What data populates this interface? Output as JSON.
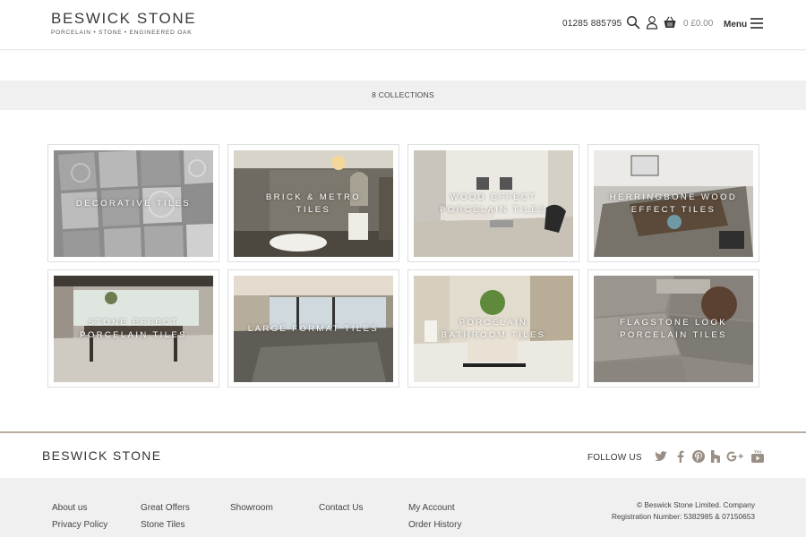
{
  "header": {
    "logo_title": "BESWICK STONE",
    "logo_tagline": "PORCELAIN • STONE • ENGINEERED OAK",
    "phone": "01285 885795",
    "cart_total": "0 £0.00",
    "menu_label": "Menu"
  },
  "collections_bar": {
    "label": "8 COLLECTIONS"
  },
  "collections": [
    {
      "label": "DECORATIVE TILES"
    },
    {
      "label": "BRICK & METRO\nTILES"
    },
    {
      "label": "WOOD EFFECT\nPORCELAIN TILES"
    },
    {
      "label": "HERRINGBONE WOOD\nEFFECT TILES"
    },
    {
      "label": "STONE EFFECT\nPORCELAIN TILES"
    },
    {
      "label": "LARGE FORMAT TILES"
    },
    {
      "label": "PORCELAIN\nBATHROOM TILES"
    },
    {
      "label": "FLAGSTONE LOOK\nPORCELAIN TILES"
    }
  ],
  "footer": {
    "logo": "BESWICK STONE",
    "follow_label": "FOLLOW US",
    "social_icons": [
      "twitter-icon",
      "facebook-icon",
      "pinterest-icon",
      "houzz-icon",
      "google-plus-icon",
      "youtube-icon"
    ],
    "social_color": "#9a8f84",
    "links": [
      [
        "About us",
        "Privacy Policy"
      ],
      [
        "Great Offers",
        "Stone Tiles"
      ],
      [
        "Showroom"
      ],
      [
        "Contact Us"
      ],
      [
        "My Account",
        "Order History"
      ]
    ],
    "copyright_line1": "© Beswick Stone Limited. Company",
    "copyright_line2": "Registration Number: 5382985 & 07150653"
  },
  "colors": {
    "band_background": "#f0f0f0",
    "footer_rule": "#b9ad9f",
    "text": "#333333"
  }
}
